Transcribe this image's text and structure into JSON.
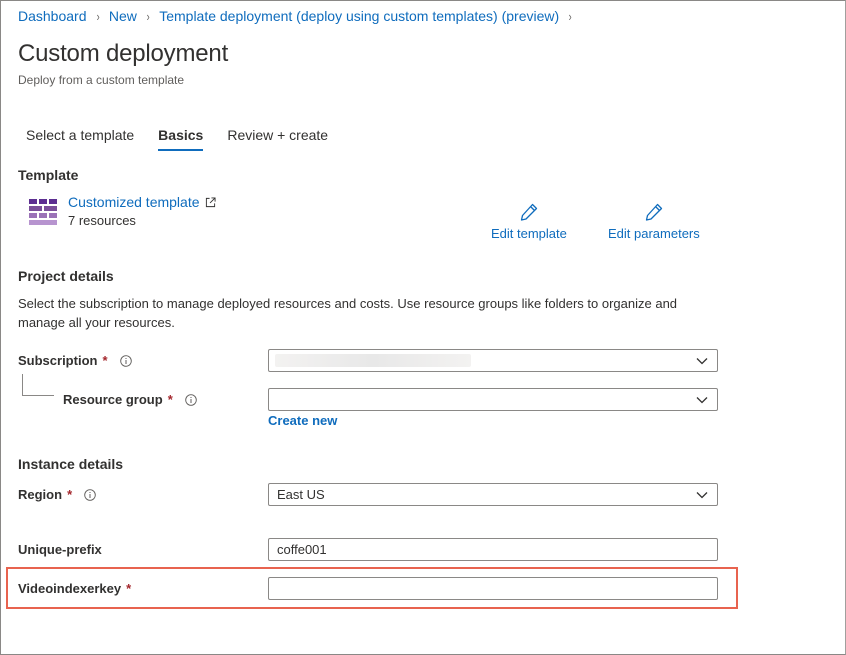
{
  "breadcrumb": {
    "items": [
      "Dashboard",
      "New",
      "Template deployment (deploy using custom templates) (preview)"
    ],
    "separator": "›"
  },
  "page": {
    "title": "Custom deployment",
    "subtitle": "Deploy from a custom template"
  },
  "tabs": [
    {
      "label": "Select a template",
      "active": false
    },
    {
      "label": "Basics",
      "active": true
    },
    {
      "label": "Review + create",
      "active": false
    }
  ],
  "template": {
    "heading": "Template",
    "name": "Customized template",
    "resources": "7 resources",
    "edit_template": "Edit template",
    "edit_parameters": "Edit parameters"
  },
  "project": {
    "heading": "Project details",
    "description": "Select the subscription to manage deployed resources and costs. Use resource groups like folders to organize and manage all your resources.",
    "subscription_label": "Subscription",
    "subscription_value": "",
    "resource_group_label": "Resource group",
    "resource_group_value": "",
    "create_new": "Create new"
  },
  "instance": {
    "heading": "Instance details",
    "region_label": "Region",
    "region_value": "East US",
    "unique_prefix_label": "Unique-prefix",
    "unique_prefix_value": "coffe001",
    "videoindexerkey_label": "Videoindexerkey",
    "videoindexerkey_value": ""
  },
  "required_marker": "*",
  "colors": {
    "link": "#0f6cbd",
    "required": "#a4262c",
    "highlight": "#e8634f",
    "icon_purple": "#7a4f9a"
  },
  "icons": [
    "external-link-icon",
    "pencil-icon",
    "info-icon",
    "chevron-down-icon",
    "template-grid-icon"
  ]
}
